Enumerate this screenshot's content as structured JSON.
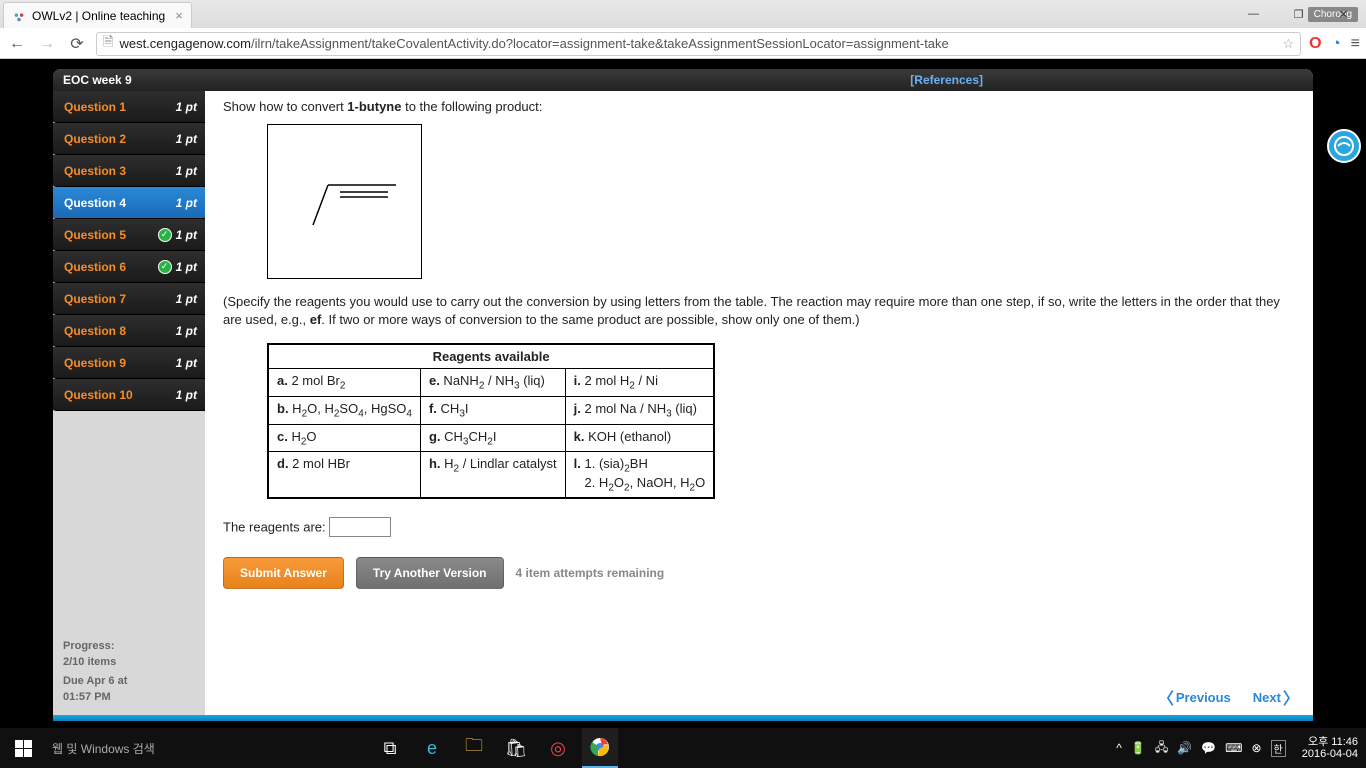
{
  "browser": {
    "tab_title": "OWLv2 | Online teaching",
    "profile": "Chorong",
    "url_prefix": "west.cengagenow.com",
    "url_path": "/ilrn/takeAssignment/takeCovalentActivity.do?locator=assignment-take&takeAssignmentSessionLocator=assignment-take"
  },
  "header": {
    "assignment": "EOC week 9",
    "references": "[References]"
  },
  "sidebar": {
    "items": [
      {
        "label": "Question 1",
        "pts": "1 pt",
        "done": false,
        "active": false
      },
      {
        "label": "Question 2",
        "pts": "1 pt",
        "done": false,
        "active": false
      },
      {
        "label": "Question 3",
        "pts": "1 pt",
        "done": false,
        "active": false
      },
      {
        "label": "Question 4",
        "pts": "1 pt",
        "done": false,
        "active": true
      },
      {
        "label": "Question 5",
        "pts": "1 pt",
        "done": true,
        "active": false
      },
      {
        "label": "Question 6",
        "pts": "1 pt",
        "done": true,
        "active": false
      },
      {
        "label": "Question 7",
        "pts": "1 pt",
        "done": false,
        "active": false
      },
      {
        "label": "Question 8",
        "pts": "1 pt",
        "done": false,
        "active": false
      },
      {
        "label": "Question 9",
        "pts": "1 pt",
        "done": false,
        "active": false
      },
      {
        "label": "Question 10",
        "pts": "1 pt",
        "done": false,
        "active": false
      }
    ],
    "progress_label": "Progress:",
    "progress_value": "2/10 items",
    "due_label": "Due Apr 6 at",
    "due_time": "01:57 PM"
  },
  "content": {
    "prompt_pre": "Show how to convert ",
    "prompt_bold": "1-butyne",
    "prompt_post": " to the following product:",
    "note": "(Specify the reagents you would use to carry out the conversion by using letters from the table. The reaction may require more than one step, if so, write the letters in the order that they are used, e.g., ef. If two or more ways of conversion to the same product are possible, show only one of them.)",
    "table_header": "Reagents available",
    "reagents": {
      "a": "2 mol Br₂",
      "b": "H₂O, H₂SO₄, HgSO₄",
      "c": "H₂O",
      "d": "2 mol HBr",
      "e": "NaNH₂ / NH₃ (liq)",
      "f": "CH₃I",
      "g": "CH₃CH₂I",
      "h": "H₂ / Lindlar catalyst",
      "i": "2 mol H₂ / Ni",
      "j": "2 mol Na / NH₃ (liq)",
      "k": "KOH (ethanol)",
      "l": "1. (sia)₂BH\n2. H₂O₂, NaOH, H₂O"
    },
    "answer_label": "The reagents are:",
    "submit": "Submit Answer",
    "try_another": "Try Another Version",
    "attempts": "4 item attempts remaining",
    "prev": "Previous",
    "next": "Next"
  },
  "taskbar": {
    "search": "웹 및 Windows 검색",
    "time": "오후 11:46",
    "date": "2016-04-04"
  }
}
